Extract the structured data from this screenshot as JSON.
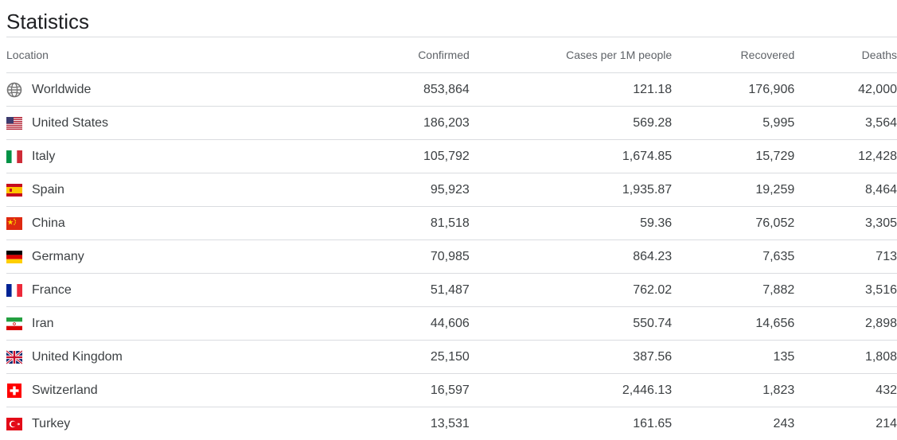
{
  "page": {
    "title": "Statistics"
  },
  "table": {
    "headers": {
      "location": "Location",
      "confirmed": "Confirmed",
      "cases_per_1m": "Cases per 1M people",
      "recovered": "Recovered",
      "deaths": "Deaths"
    },
    "rows": [
      {
        "location": "Worldwide",
        "icon": "globe-icon",
        "confirmed": "853,864",
        "cases_per_1m": "121.18",
        "recovered": "176,906",
        "deaths": "42,000"
      },
      {
        "location": "United States",
        "icon": "us-flag-icon",
        "confirmed": "186,203",
        "cases_per_1m": "569.28",
        "recovered": "5,995",
        "deaths": "3,564"
      },
      {
        "location": "Italy",
        "icon": "italy-flag-icon",
        "confirmed": "105,792",
        "cases_per_1m": "1,674.85",
        "recovered": "15,729",
        "deaths": "12,428"
      },
      {
        "location": "Spain",
        "icon": "spain-flag-icon",
        "confirmed": "95,923",
        "cases_per_1m": "1,935.87",
        "recovered": "19,259",
        "deaths": "8,464"
      },
      {
        "location": "China",
        "icon": "china-flag-icon",
        "confirmed": "81,518",
        "cases_per_1m": "59.36",
        "recovered": "76,052",
        "deaths": "3,305"
      },
      {
        "location": "Germany",
        "icon": "germany-flag-icon",
        "confirmed": "70,985",
        "cases_per_1m": "864.23",
        "recovered": "7,635",
        "deaths": "713"
      },
      {
        "location": "France",
        "icon": "france-flag-icon",
        "confirmed": "51,487",
        "cases_per_1m": "762.02",
        "recovered": "7,882",
        "deaths": "3,516"
      },
      {
        "location": "Iran",
        "icon": "iran-flag-icon",
        "confirmed": "44,606",
        "cases_per_1m": "550.74",
        "recovered": "14,656",
        "deaths": "2,898"
      },
      {
        "location": "United Kingdom",
        "icon": "uk-flag-icon",
        "confirmed": "25,150",
        "cases_per_1m": "387.56",
        "recovered": "135",
        "deaths": "1,808"
      },
      {
        "location": "Switzerland",
        "icon": "switzerland-flag-icon",
        "confirmed": "16,597",
        "cases_per_1m": "2,446.13",
        "recovered": "1,823",
        "deaths": "432"
      },
      {
        "location": "Turkey",
        "icon": "turkey-flag-icon",
        "confirmed": "13,531",
        "cases_per_1m": "161.65",
        "recovered": "243",
        "deaths": "214"
      }
    ]
  },
  "colors": {
    "text": "#3c4043",
    "header_text": "#5f6368",
    "divider": "#dadce0"
  }
}
